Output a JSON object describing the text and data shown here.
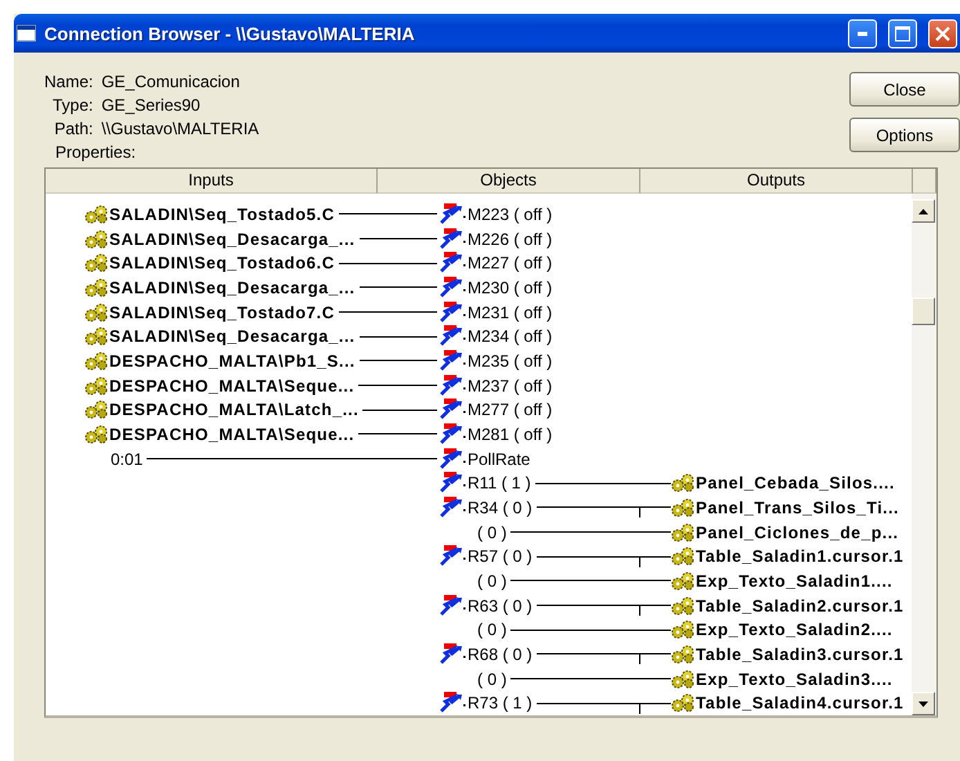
{
  "window": {
    "title": "Connection Browser - \\\\Gustavo\\MALTERIA"
  },
  "details": [
    {
      "label": "Name:",
      "value": "GE_Comunicacion"
    },
    {
      "label": "Type:",
      "value": "GE_Series90"
    },
    {
      "label": "Path:",
      "value": "\\\\Gustavo\\MALTERIA"
    }
  ],
  "properties_label": "Properties:",
  "buttons": [
    "Close",
    "Options"
  ],
  "table": {
    "columns": [
      "Inputs",
      "Objects",
      "Outputs"
    ],
    "rows": [
      {
        "input": {
          "kind": "point",
          "text": "SALADIN\\Seq_Tostado5.C"
        },
        "object": {
          "kind": "tag",
          "text": "M223 ( off )"
        }
      },
      {
        "input": {
          "kind": "point",
          "text": "SALADIN\\Seq_Desacarga_..."
        },
        "object": {
          "kind": "tag",
          "text": "M226 ( off )"
        }
      },
      {
        "input": {
          "kind": "point",
          "text": "SALADIN\\Seq_Tostado6.C"
        },
        "object": {
          "kind": "tag",
          "text": "M227 ( off )"
        }
      },
      {
        "input": {
          "kind": "point",
          "text": "SALADIN\\Seq_Desacarga_..."
        },
        "object": {
          "kind": "tag",
          "text": "M230 ( off )"
        }
      },
      {
        "input": {
          "kind": "point",
          "text": "SALADIN\\Seq_Tostado7.C"
        },
        "object": {
          "kind": "tag",
          "text": "M231 ( off )"
        }
      },
      {
        "input": {
          "kind": "point",
          "text": "SALADIN\\Seq_Desacarga_..."
        },
        "object": {
          "kind": "tag",
          "text": "M234 ( off )"
        }
      },
      {
        "input": {
          "kind": "point",
          "text": "DESPACHO_MALTA\\Pb1_S..."
        },
        "object": {
          "kind": "tag",
          "text": "M235 ( off )"
        }
      },
      {
        "input": {
          "kind": "point",
          "text": "DESPACHO_MALTA\\Seque..."
        },
        "object": {
          "kind": "tag",
          "text": "M237 ( off )"
        }
      },
      {
        "input": {
          "kind": "point",
          "text": "DESPACHO_MALTA\\Latch_..."
        },
        "object": {
          "kind": "tag",
          "text": "M277 ( off )"
        }
      },
      {
        "input": {
          "kind": "point",
          "text": "DESPACHO_MALTA\\Seque..."
        },
        "object": {
          "kind": "tag",
          "text": "M281 ( off )"
        }
      },
      {
        "input": {
          "kind": "value",
          "text": "0:01"
        },
        "object": {
          "kind": "tag",
          "text": "PollRate"
        }
      },
      {
        "object": {
          "kind": "tag",
          "text": "R11 ( 1 )"
        },
        "output": {
          "text": "Panel_Cebada_Silos....",
          "branch": false
        }
      },
      {
        "object": {
          "kind": "tag",
          "text": "R34 ( 0 )"
        },
        "output": {
          "text": "Panel_Trans_Silos_Ti...",
          "branch": true
        }
      },
      {
        "object": {
          "kind": "value",
          "text": "( 0 )"
        },
        "output": {
          "text": "Panel_Ciclones_de_p...",
          "branch": false
        }
      },
      {
        "object": {
          "kind": "tag",
          "text": "R57 ( 0 )"
        },
        "output": {
          "text": "Table_Saladin1.cursor.1",
          "branch": true
        }
      },
      {
        "object": {
          "kind": "value",
          "text": "( 0 )"
        },
        "output": {
          "text": "Exp_Texto_Saladin1....",
          "branch": false
        }
      },
      {
        "object": {
          "kind": "tag",
          "text": "R63 ( 0 )"
        },
        "output": {
          "text": "Table_Saladin2.cursor.1",
          "branch": true
        }
      },
      {
        "object": {
          "kind": "value",
          "text": "( 0 )"
        },
        "output": {
          "text": "Exp_Texto_Saladin2....",
          "branch": false
        }
      },
      {
        "object": {
          "kind": "tag",
          "text": "R68 ( 0 )"
        },
        "output": {
          "text": "Table_Saladin3.cursor.1",
          "branch": true
        }
      },
      {
        "object": {
          "kind": "value",
          "text": "( 0 )"
        },
        "output": {
          "text": "Exp_Texto_Saladin3....",
          "branch": false
        }
      },
      {
        "object": {
          "kind": "tag",
          "text": "R73 ( 1 )"
        },
        "output": {
          "text": "Table_Saladin4.cursor.1",
          "branch": true
        }
      }
    ]
  }
}
